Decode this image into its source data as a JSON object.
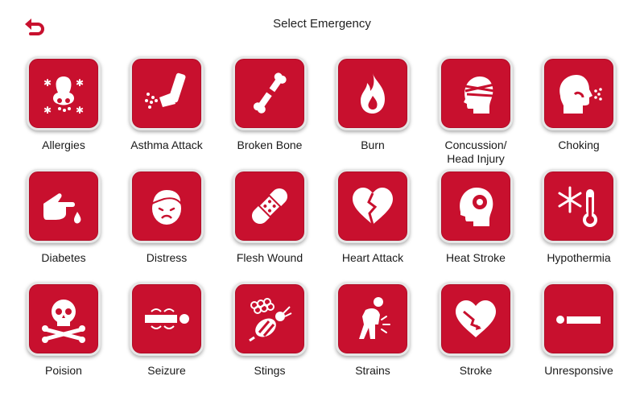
{
  "header": {
    "title": "Select Emergency",
    "back_icon": "back-arrow-icon"
  },
  "theme": {
    "accent": "#c8102e",
    "text": "#222222",
    "background": "#ffffff"
  },
  "emergencies": [
    {
      "label": "Allergies",
      "icon": "allergies-icon"
    },
    {
      "label": "Asthma Attack",
      "icon": "inhaler-icon"
    },
    {
      "label": "Broken Bone",
      "icon": "broken-bone-icon"
    },
    {
      "label": "Burn",
      "icon": "flame-icon"
    },
    {
      "label": "Concussion/\nHead Injury",
      "icon": "bandaged-head-icon"
    },
    {
      "label": "Choking",
      "icon": "choking-icon"
    },
    {
      "label": "Diabetes",
      "icon": "finger-blood-drop-icon"
    },
    {
      "label": "Distress",
      "icon": "distressed-face-icon"
    },
    {
      "label": "Flesh Wound",
      "icon": "bandage-icon"
    },
    {
      "label": "Heart Attack",
      "icon": "broken-heart-icon"
    },
    {
      "label": "Heat Stroke",
      "icon": "hot-head-icon"
    },
    {
      "label": "Hypothermia",
      "icon": "snowflake-thermometer-icon"
    },
    {
      "label": "Poision",
      "icon": "skull-crossbones-icon"
    },
    {
      "label": "Seizure",
      "icon": "seizure-icon"
    },
    {
      "label": "Stings",
      "icon": "bee-icon"
    },
    {
      "label": "Strains",
      "icon": "strain-icon"
    },
    {
      "label": "Stroke",
      "icon": "heart-zigzag-icon"
    },
    {
      "label": "Unresponsive",
      "icon": "lying-person-icon"
    }
  ]
}
